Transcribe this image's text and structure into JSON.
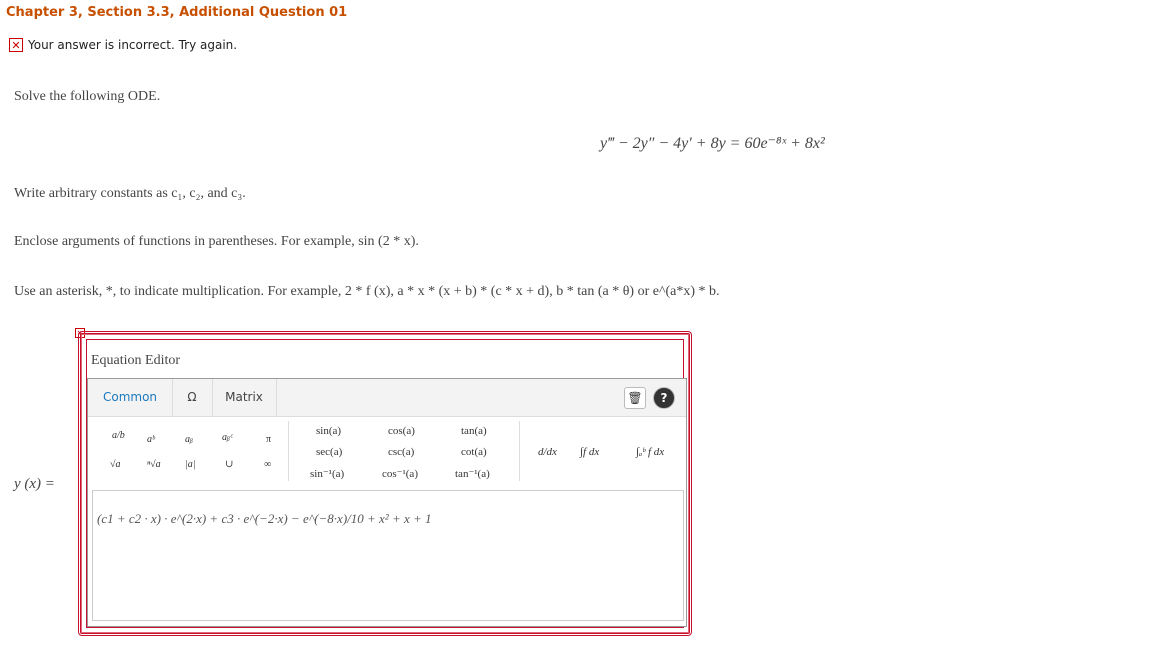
{
  "header": {
    "title": "Chapter 3, Section 3.3, Additional Question 01"
  },
  "feedback": {
    "icon": "x-icon",
    "message": "Your answer is incorrect.  Try again."
  },
  "problem": {
    "prompt": "Solve the following ODE.",
    "equation": "y‴ − 2y″ − 4y′ + 8y = 60e⁻⁸ˣ + 8x²",
    "instruction_constants": "Write arbitrary constants as c₁, c₂, and c₃.",
    "instruction_parentheses": "Enclose arguments of functions in parentheses. For example, sin (2 * x).",
    "instruction_asterisk": "Use an asterisk, *, to indicate multiplication. For example, 2 * f (x), a * x * (x + b) * (c * x + d), b * tan (a * θ) or e^(a*x) * b."
  },
  "editor": {
    "title": "Equation Editor",
    "tabs": [
      "Common",
      "Ω",
      "Matrix"
    ],
    "active_tab": "Common",
    "buttons": {
      "trash": "🗑",
      "help": "?"
    },
    "symbols_row1": [
      "a/b",
      "aᵇ",
      "aᵦ",
      "aᵦᶜ",
      "π"
    ],
    "symbols_row2": [
      "√a",
      "ⁿ√a",
      "|a|",
      "∪",
      "∞"
    ],
    "functions": [
      [
        "sin(a)",
        "cos(a)",
        "tan(a)"
      ],
      [
        "sec(a)",
        "csc(a)",
        "cot(a)"
      ],
      [
        "sin⁻¹(a)",
        "cos⁻¹(a)",
        "tan⁻¹(a)"
      ]
    ],
    "calculus": [
      "d/dx",
      "∫f dx",
      "∫ₐᵇ f dx"
    ],
    "answer_value": "(c1 + c2 · x) · e^(2·x) + c3 · e^(−2·x) − e^(−8·x)/10 + x² + x + 1"
  },
  "answer_label": "y (x) ="
}
